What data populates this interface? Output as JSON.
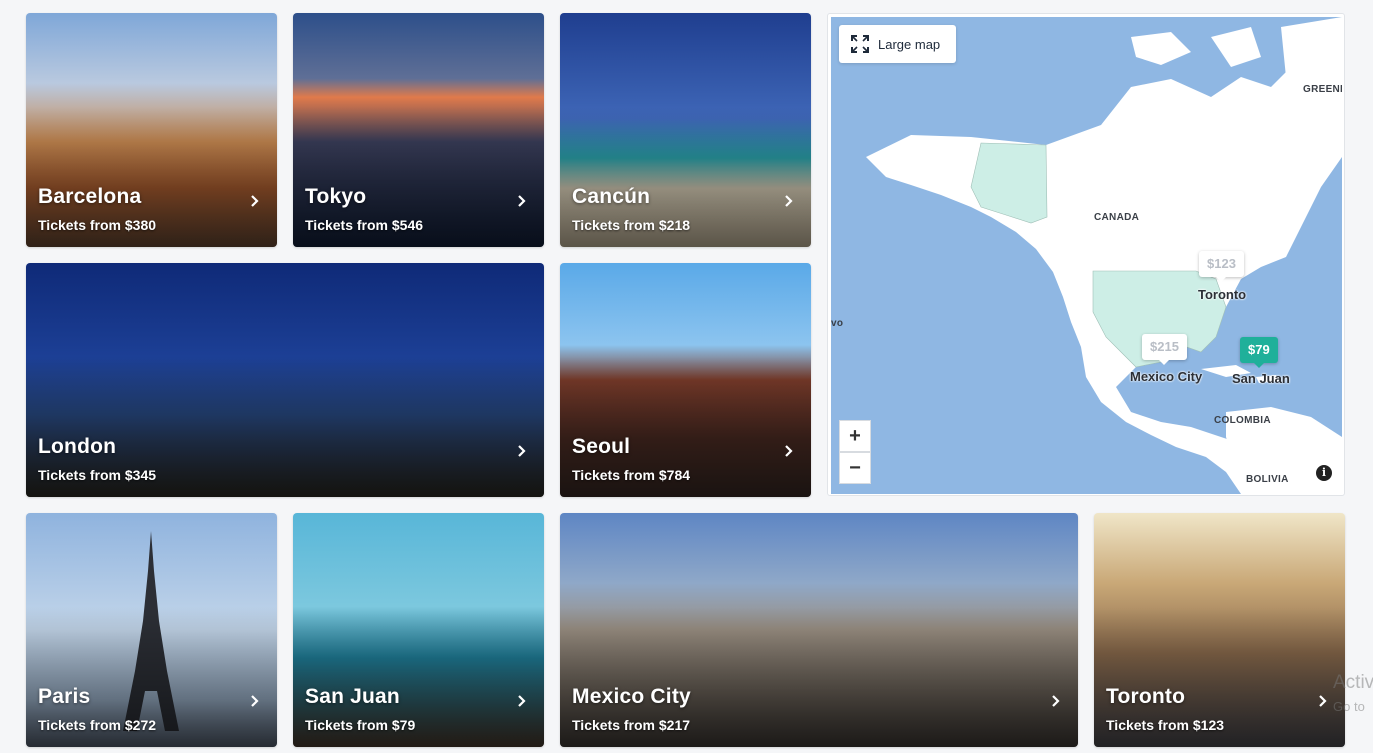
{
  "price_prefix": "Tickets from",
  "destinations": [
    {
      "name": "Barcelona",
      "price": "$380"
    },
    {
      "name": "Tokyo",
      "price": "$546"
    },
    {
      "name": "Cancún",
      "price": "$218"
    },
    {
      "name": "London",
      "price": "$345"
    },
    {
      "name": "Seoul",
      "price": "$784"
    },
    {
      "name": "Paris",
      "price": "$272"
    },
    {
      "name": "San Juan",
      "price": "$79"
    },
    {
      "name": "Mexico City",
      "price": "$217"
    },
    {
      "name": "Toronto",
      "price": "$123"
    }
  ],
  "map": {
    "large_map_label": "Large map",
    "zoom_in": "+",
    "zoom_out": "−",
    "info": "i",
    "region_labels": {
      "greenland": "GREENL",
      "canada": "CANADA",
      "colombia": "COLOMBIA",
      "bolivia": "BOLIVIA",
      "edge": "vo"
    },
    "pins": [
      {
        "price": "$123",
        "city": "Toronto",
        "active": false
      },
      {
        "price": "$215",
        "city": "Mexico City",
        "active": false
      },
      {
        "price": "$79",
        "city": "San Juan",
        "active": true
      }
    ],
    "colors": {
      "sea": "#8fb7e3",
      "land": "#ffffff",
      "highlight": "#cdeee6",
      "active_pin": "#1fb09a"
    }
  },
  "os_watermark": {
    "line1": "Activ",
    "line2": "Go to"
  }
}
